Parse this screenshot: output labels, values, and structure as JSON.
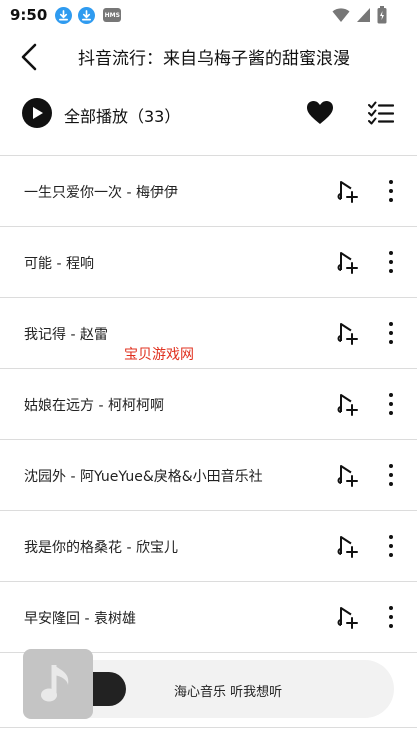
{
  "status_bar": {
    "time": "9:50",
    "badge_label": "HMS",
    "icons": [
      "download-icon",
      "download-icon",
      "hms-icon",
      "wifi-icon",
      "signal-icon",
      "battery-icon"
    ]
  },
  "header": {
    "back_icon": "back-arrow-icon",
    "title": "抖音流行：来自乌梅子酱的甜蜜浪漫"
  },
  "playall": {
    "label": "全部播放（33）",
    "play_icon": "play-icon",
    "favorite_icon": "heart-icon",
    "multiselect_icon": "checklist-icon"
  },
  "songs": [
    {
      "title": "一生只爱你一次 - 梅伊伊"
    },
    {
      "title": "可能 - 程响"
    },
    {
      "title": "我记得 - 赵雷"
    },
    {
      "title": "姑娘在远方 - 柯柯柯啊"
    },
    {
      "title": "沈园外 - 阿YueYue&戾格&小田音乐社"
    },
    {
      "title": "我是你的格桑花 - 欣宝儿"
    },
    {
      "title": "早安隆回 - 袁树雄"
    }
  ],
  "watermark": "宝贝游戏网",
  "mini_player": {
    "text": "海心音乐 听我想听",
    "cover_icon": "music-note-icon"
  },
  "colors": {
    "accent": "#111111",
    "divider": "#dcdcdc",
    "watermark": "#e0311f",
    "status_badge": "#2f9bf0"
  }
}
